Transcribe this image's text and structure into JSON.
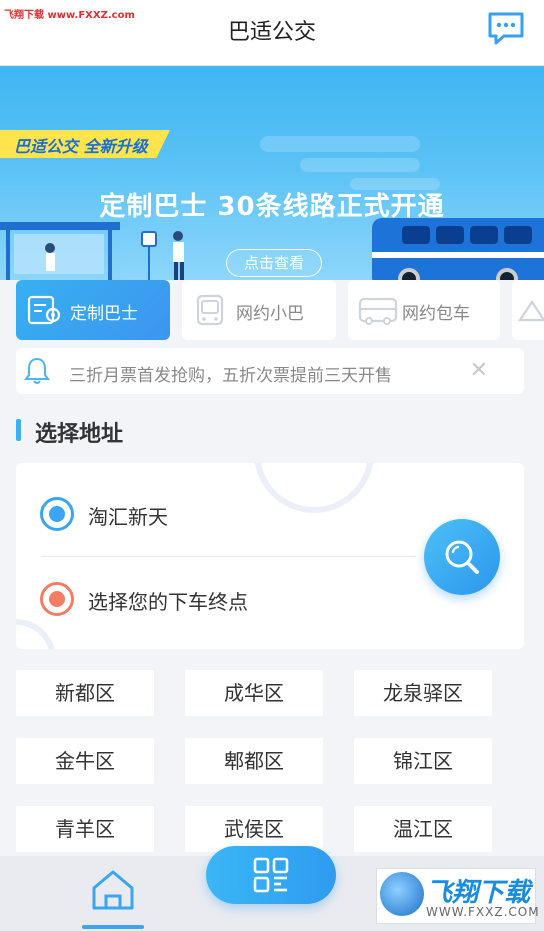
{
  "header": {
    "watermark": "飞翔下载 www.FXXZ.com",
    "title": "巴适公交",
    "message_icon": "chat-bubble-icon"
  },
  "banner": {
    "tag": "巴适公交 全新升级",
    "headline": "定制巴士 30条线路正式开通",
    "cta": "点击查看"
  },
  "services": [
    {
      "label": "定制巴士",
      "icon": "bus-ticket-icon",
      "active": true
    },
    {
      "label": "网约小巴",
      "icon": "minibus-icon",
      "active": false
    },
    {
      "label": "网约包车",
      "icon": "charter-bus-icon",
      "active": false
    }
  ],
  "notice": {
    "icon": "bell-icon",
    "text": "三折月票首发抢购，五折次票提前三天开售",
    "close_icon": "close-icon"
  },
  "section": {
    "title": "选择地址"
  },
  "address": {
    "from": "淘汇新天",
    "to": "选择您的下车终点",
    "search_icon": "search-icon"
  },
  "districts": [
    "新都区",
    "成华区",
    "龙泉驿区",
    "金牛区",
    "郫都区",
    "锦江区",
    "青羊区",
    "武侯区",
    "温江区"
  ],
  "bottom_nav": {
    "home_icon": "home-icon",
    "scan_icon": "qr-scan-icon"
  },
  "watermark": {
    "brand": "飞翔下载",
    "url": "WWW.FXXZ.COM"
  },
  "colors": {
    "accent": "#3aa5f2",
    "destination": "#f47d63",
    "tag": "#ffe44d"
  }
}
